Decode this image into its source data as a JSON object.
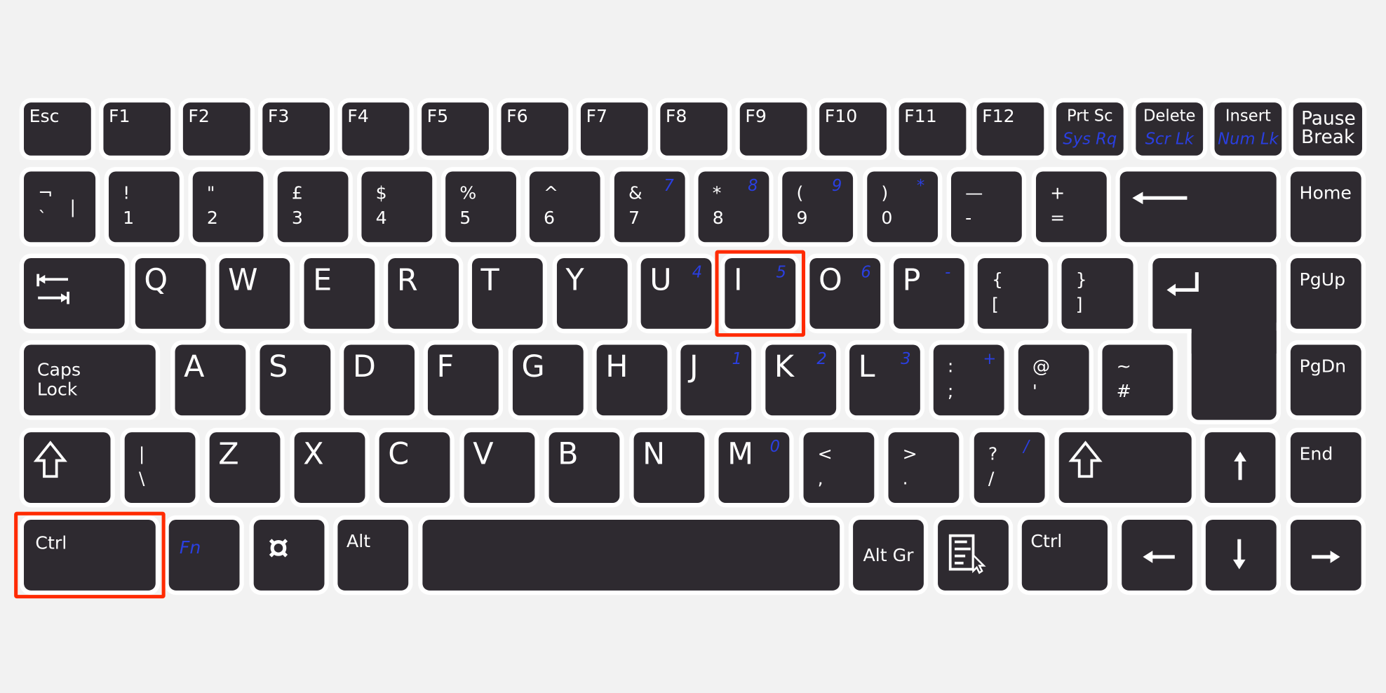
{
  "colors": {
    "background": "#f2f2f2",
    "key": "#2e2a30",
    "legend": "#ffffff",
    "fn_legend": "#2a3fe0",
    "highlight": "#ff2a00"
  },
  "rows": [
    [
      {
        "type": "fn",
        "main": "Esc"
      },
      {
        "type": "fn",
        "main": "F1"
      },
      {
        "type": "fn",
        "main": "F2"
      },
      {
        "type": "fn",
        "main": "F3"
      },
      {
        "type": "fn",
        "main": "F4"
      },
      {
        "type": "fn",
        "main": "F5"
      },
      {
        "type": "fn",
        "main": "F6"
      },
      {
        "type": "fn",
        "main": "F7"
      },
      {
        "type": "fn",
        "main": "F8"
      },
      {
        "type": "fn",
        "main": "F9"
      },
      {
        "type": "fn",
        "main": "F10"
      },
      {
        "type": "fn",
        "main": "F11"
      },
      {
        "type": "fn",
        "main": "F12"
      },
      {
        "type": "sys",
        "main": "Prt Sc",
        "fn": "Sys Rq"
      },
      {
        "type": "sys",
        "main": "Delete",
        "fn": "Scr Lk"
      },
      {
        "type": "sys",
        "main": "Insert",
        "fn": "Num Lk"
      },
      {
        "type": "pause",
        "main": "Pause",
        "shift": "Break"
      }
    ],
    [
      {
        "type": "dual",
        "shift": "¬",
        "main": "`",
        "extra": "|"
      },
      {
        "type": "dual",
        "shift": "!",
        "main": "1"
      },
      {
        "type": "dual",
        "shift": "\"",
        "main": "2"
      },
      {
        "type": "dual",
        "shift": "£",
        "main": "3"
      },
      {
        "type": "dual",
        "shift": "$",
        "main": "4"
      },
      {
        "type": "dual",
        "shift": "%",
        "main": "5"
      },
      {
        "type": "dual",
        "shift": "^",
        "main": "6"
      },
      {
        "type": "dual",
        "shift": "&",
        "main": "7",
        "fn": "7"
      },
      {
        "type": "dual",
        "shift": "*",
        "main": "8",
        "fn": "8"
      },
      {
        "type": "dual",
        "shift": "(",
        "main": "9",
        "fn": "9"
      },
      {
        "type": "dual",
        "shift": ")",
        "main": "0",
        "fn": "*"
      },
      {
        "type": "dual",
        "shift": "—",
        "main": "-"
      },
      {
        "type": "dual",
        "shift": "+",
        "main": "="
      },
      {
        "type": "icon",
        "icon": "backspace-arrow-icon",
        "name": "Backspace"
      },
      {
        "type": "word",
        "main": "Home"
      }
    ],
    [
      {
        "type": "icon",
        "icon": "tab-icon",
        "name": "Tab"
      },
      {
        "type": "letter",
        "main": "Q"
      },
      {
        "type": "letter",
        "main": "W"
      },
      {
        "type": "letter",
        "main": "E"
      },
      {
        "type": "letter",
        "main": "R"
      },
      {
        "type": "letter",
        "main": "T"
      },
      {
        "type": "letter",
        "main": "Y"
      },
      {
        "type": "letter",
        "main": "U",
        "fn": "4"
      },
      {
        "type": "letter",
        "main": "I",
        "fn": "5",
        "highlighted": true
      },
      {
        "type": "letter",
        "main": "O",
        "fn": "6"
      },
      {
        "type": "letter",
        "main": "P",
        "fn": "-"
      },
      {
        "type": "dual",
        "shift": "{",
        "main": "["
      },
      {
        "type": "dual",
        "shift": "}",
        "main": "]"
      },
      {
        "type": "icon",
        "icon": "enter-icon",
        "name": "Enter"
      },
      {
        "type": "word",
        "main": "PgUp"
      }
    ],
    [
      {
        "type": "pause",
        "main": "Caps",
        "shift": "Lock"
      },
      {
        "type": "letter",
        "main": "A"
      },
      {
        "type": "letter",
        "main": "S"
      },
      {
        "type": "letter",
        "main": "D"
      },
      {
        "type": "letter",
        "main": "F"
      },
      {
        "type": "letter",
        "main": "G"
      },
      {
        "type": "letter",
        "main": "H"
      },
      {
        "type": "letter",
        "main": "J",
        "fn": "1"
      },
      {
        "type": "letter",
        "main": "K",
        "fn": "2"
      },
      {
        "type": "letter",
        "main": "L",
        "fn": "3"
      },
      {
        "type": "dual",
        "shift": ":",
        "main": ";",
        "fn": "+"
      },
      {
        "type": "dual",
        "shift": "@",
        "main": "'"
      },
      {
        "type": "dual",
        "shift": "~",
        "main": "#"
      },
      {
        "type": "word",
        "main": "PgDn"
      }
    ],
    [
      {
        "type": "icon",
        "icon": "shift-icon",
        "name": "Shift"
      },
      {
        "type": "dual",
        "shift": "|",
        "main": "\\"
      },
      {
        "type": "letter",
        "main": "Z"
      },
      {
        "type": "letter",
        "main": "X"
      },
      {
        "type": "letter",
        "main": "C"
      },
      {
        "type": "letter",
        "main": "V"
      },
      {
        "type": "letter",
        "main": "B"
      },
      {
        "type": "letter",
        "main": "N"
      },
      {
        "type": "letter",
        "main": "M",
        "fn": "0"
      },
      {
        "type": "dual",
        "shift": "<",
        "main": ","
      },
      {
        "type": "dual",
        "shift": ">",
        "main": "."
      },
      {
        "type": "dual",
        "shift": "?",
        "main": "/",
        "fn": "/"
      },
      {
        "type": "icon",
        "icon": "shift-icon",
        "name": "Shift"
      },
      {
        "type": "icon",
        "icon": "arrow-up-icon",
        "name": "Up"
      },
      {
        "type": "word",
        "main": "End"
      }
    ],
    [
      {
        "type": "word",
        "main": "Ctrl",
        "highlighted": true
      },
      {
        "type": "wordblue",
        "main": "Fn"
      },
      {
        "type": "icon",
        "icon": "os-key-icon",
        "name": "Super"
      },
      {
        "type": "word",
        "main": "Alt"
      },
      {
        "type": "blank",
        "name": "Space"
      },
      {
        "type": "center",
        "main": "Alt Gr"
      },
      {
        "type": "icon",
        "icon": "menu-key-icon",
        "name": "Menu"
      },
      {
        "type": "word",
        "main": "Ctrl"
      },
      {
        "type": "icon",
        "icon": "arrow-left-icon",
        "name": "Left"
      },
      {
        "type": "icon",
        "icon": "arrow-down-icon",
        "name": "Down"
      },
      {
        "type": "icon",
        "icon": "arrow-right-icon",
        "name": "Right"
      }
    ]
  ]
}
